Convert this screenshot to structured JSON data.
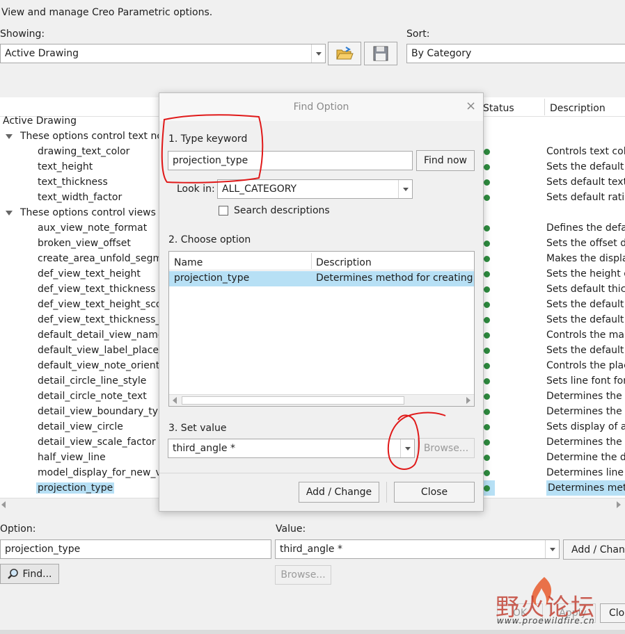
{
  "header": {
    "description": "View and manage Creo Parametric options."
  },
  "showing": {
    "label": "Showing:",
    "value": "Active Drawing"
  },
  "sort": {
    "label": "Sort:",
    "value": "By Category"
  },
  "table": {
    "col_status": "Status",
    "col_description": "Description",
    "root": "Active Drawing",
    "groups": [
      {
        "label": "These options control text not",
        "row": 1
      },
      {
        "label": "These options control views ar",
        "row": 6
      }
    ],
    "items": [
      {
        "name": "drawing_text_color",
        "desc": "Controls text colo",
        "row": 2
      },
      {
        "name": "text_height",
        "desc": "Sets the default te",
        "row": 3
      },
      {
        "name": "text_thickness",
        "desc": "Sets default text t",
        "row": 4
      },
      {
        "name": "text_width_factor",
        "desc": "Sets default ratio",
        "row": 5
      },
      {
        "name": "aux_view_note_format",
        "desc": "Defines the defau",
        "row": 7
      },
      {
        "name": "broken_view_offset",
        "desc": "Sets the offset dis",
        "row": 8
      },
      {
        "name": "create_area_unfold_segme",
        "desc": "Makes the display",
        "row": 9
      },
      {
        "name": "def_view_text_height",
        "desc": "Sets the height of",
        "row": 10
      },
      {
        "name": "def_view_text_thickness",
        "desc": "Sets default thick",
        "row": 11
      },
      {
        "name": "def_view_text_height_scop",
        "desc": "Sets the default v",
        "row": 12
      },
      {
        "name": "def_view_text_thickness_sc",
        "desc": "Sets the default v",
        "row": 13
      },
      {
        "name": "default_detail_view_name_",
        "desc": "Controls the man",
        "row": 14
      },
      {
        "name": "default_view_label_placem",
        "desc": "Sets the default p",
        "row": 15
      },
      {
        "name": "default_view_note_orientat",
        "desc": "Controls the place",
        "row": 16
      },
      {
        "name": "detail_circle_line_style",
        "desc": "Sets line font for",
        "row": 17
      },
      {
        "name": "detail_circle_note_text",
        "desc": "Determines the te",
        "row": 18
      },
      {
        "name": "detail_view_boundary_type",
        "desc": "Determines the d",
        "row": 19
      },
      {
        "name": "detail_view_circle",
        "desc": "Sets display of a c",
        "row": 20
      },
      {
        "name": "detail_view_scale_factor",
        "desc": "Determines the d",
        "row": 21
      },
      {
        "name": "half_view_line",
        "desc": "Determine the dis",
        "row": 22
      },
      {
        "name": "model_display_for_new_vie",
        "desc": "Determines line d",
        "row": 23
      },
      {
        "name": "projection_type",
        "desc": "Determines meth",
        "row": 24,
        "selected": true
      }
    ]
  },
  "bottom": {
    "option_label": "Option:",
    "option_value": "projection_type",
    "value_label": "Value:",
    "value_value": "third_angle *",
    "add_change": "Add / Chang",
    "find": "Find...",
    "browse": "Browse...",
    "ok": "OK",
    "apply": "Apply",
    "close": "Clos"
  },
  "dialog": {
    "title": "Find Option",
    "step1": "1.  Type keyword",
    "keyword": "projection_type",
    "find_now": "Find now",
    "look_in_label": "Look in:",
    "look_in_value": "ALL_CATEGORY",
    "search_desc": "Search descriptions",
    "step2": "2.  Choose option",
    "col_name": "Name",
    "col_desc": "Description",
    "result_name": "projection_type",
    "result_desc": "Determines method for creating p",
    "step3": "3.  Set value",
    "set_value": "third_angle *",
    "browse": "Browse...",
    "add_change": "Add / Change",
    "close": "Close"
  },
  "watermark": {
    "chars": "野火论坛",
    "url": "www.proewildfire.cn"
  },
  "colors": {
    "selection": "#b7e0f5",
    "status_dot": "#2e8b3f",
    "annotation": "#e01919",
    "watermark": "#c0392b"
  }
}
